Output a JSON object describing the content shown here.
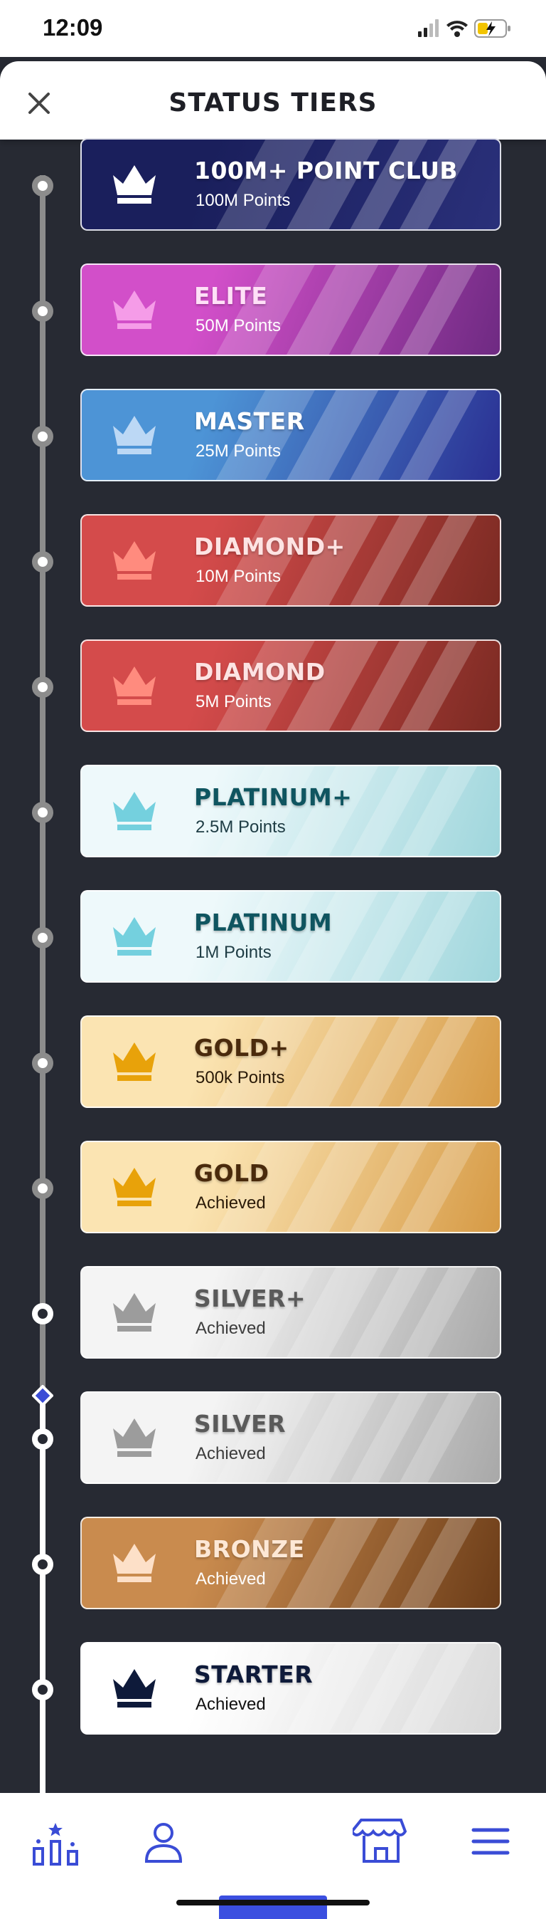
{
  "status_bar": {
    "time": "12:09"
  },
  "header": {
    "title": "STATUS TIERS",
    "close_icon": "close-icon"
  },
  "tiers": [
    {
      "name": "100M+ POINT CLUB",
      "subtitle": "100M Points",
      "status": "locked",
      "name_color": "#ffffff",
      "sub_color": "#ffffff",
      "crown_color": "#ffffff",
      "bg_start": "#1a1f5c",
      "bg_end": "#2a307a"
    },
    {
      "name": "ELITE",
      "subtitle": "50M Points",
      "status": "locked",
      "name_color": "#ffe0f7",
      "sub_color": "#ffffff",
      "crown_color": "#f59ce8",
      "bg_start": "#d24fc9",
      "bg_end": "#6e2a82"
    },
    {
      "name": "MASTER",
      "subtitle": "25M Points",
      "status": "locked",
      "name_color": "#ffffff",
      "sub_color": "#ffffff",
      "crown_color": "#bcd8f5",
      "bg_start": "#4d94d6",
      "bg_end": "#2a2f92"
    },
    {
      "name": "DIAMOND+",
      "subtitle": "10M Points",
      "status": "locked",
      "name_color": "#fde3e3",
      "sub_color": "#ffffff",
      "crown_color": "#ff8b7e",
      "bg_start": "#d44b4b",
      "bg_end": "#7a2a22"
    },
    {
      "name": "DIAMOND",
      "subtitle": "5M Points",
      "status": "locked",
      "name_color": "#fde3e3",
      "sub_color": "#ffffff",
      "crown_color": "#ff8b7e",
      "bg_start": "#d44b4b",
      "bg_end": "#7a2a22"
    },
    {
      "name": "PLATINUM+",
      "subtitle": "2.5M Points",
      "status": "locked",
      "name_color": "#0f5560",
      "sub_color": "#1e3c44",
      "crown_color": "#74d0de",
      "bg_start": "#eef9fb",
      "bg_end": "#9fd6dc"
    },
    {
      "name": "PLATINUM",
      "subtitle": "1M Points",
      "status": "locked",
      "name_color": "#0f5560",
      "sub_color": "#1e3c44",
      "crown_color": "#74d0de",
      "bg_start": "#eef9fb",
      "bg_end": "#9fd6dc"
    },
    {
      "name": "GOLD+",
      "subtitle": "500k Points",
      "status": "locked",
      "name_color": "#4a2a0c",
      "sub_color": "#2a1a08",
      "crown_color": "#e8a20a",
      "bg_start": "#fbe4b2",
      "bg_end": "#d69a45"
    },
    {
      "name": "GOLD",
      "subtitle": "Achieved",
      "status": "achieved",
      "name_color": "#4a2a0c",
      "sub_color": "#2a1a08",
      "crown_color": "#e8a20a",
      "bg_start": "#fbe4b2",
      "bg_end": "#d69a45"
    },
    {
      "name": "SILVER+",
      "subtitle": "Achieved",
      "status": "achieved",
      "name_color": "#5a5a5a",
      "sub_color": "#3c3c3c",
      "crown_color": "#9c9c9c",
      "bg_start": "#f4f4f4",
      "bg_end": "#a8a8a8"
    },
    {
      "name": "SILVER",
      "subtitle": "Achieved",
      "status": "achieved",
      "name_color": "#5a5a5a",
      "sub_color": "#3c3c3c",
      "crown_color": "#9c9c9c",
      "bg_start": "#f4f4f4",
      "bg_end": "#a8a8a8"
    },
    {
      "name": "BRONZE",
      "subtitle": "Achieved",
      "status": "achieved",
      "name_color": "#fde8d6",
      "sub_color": "#ffffff",
      "crown_color": "#fde0c8",
      "bg_start": "#c98b4e",
      "bg_end": "#6b3c18"
    },
    {
      "name": "STARTER",
      "subtitle": "Achieved",
      "status": "achieved",
      "name_color": "#0e1a3a",
      "sub_color": "#111111",
      "crown_color": "#0e1a3a",
      "bg_start": "#ffffff",
      "bg_end": "#d8d8d8"
    }
  ],
  "bottom_nav": {
    "items": [
      {
        "icon": "leaderboard-icon"
      },
      {
        "icon": "profile-icon"
      },
      {
        "icon": "store-icon"
      },
      {
        "icon": "menu-icon"
      }
    ],
    "icon_color": "#3a4cd6"
  }
}
